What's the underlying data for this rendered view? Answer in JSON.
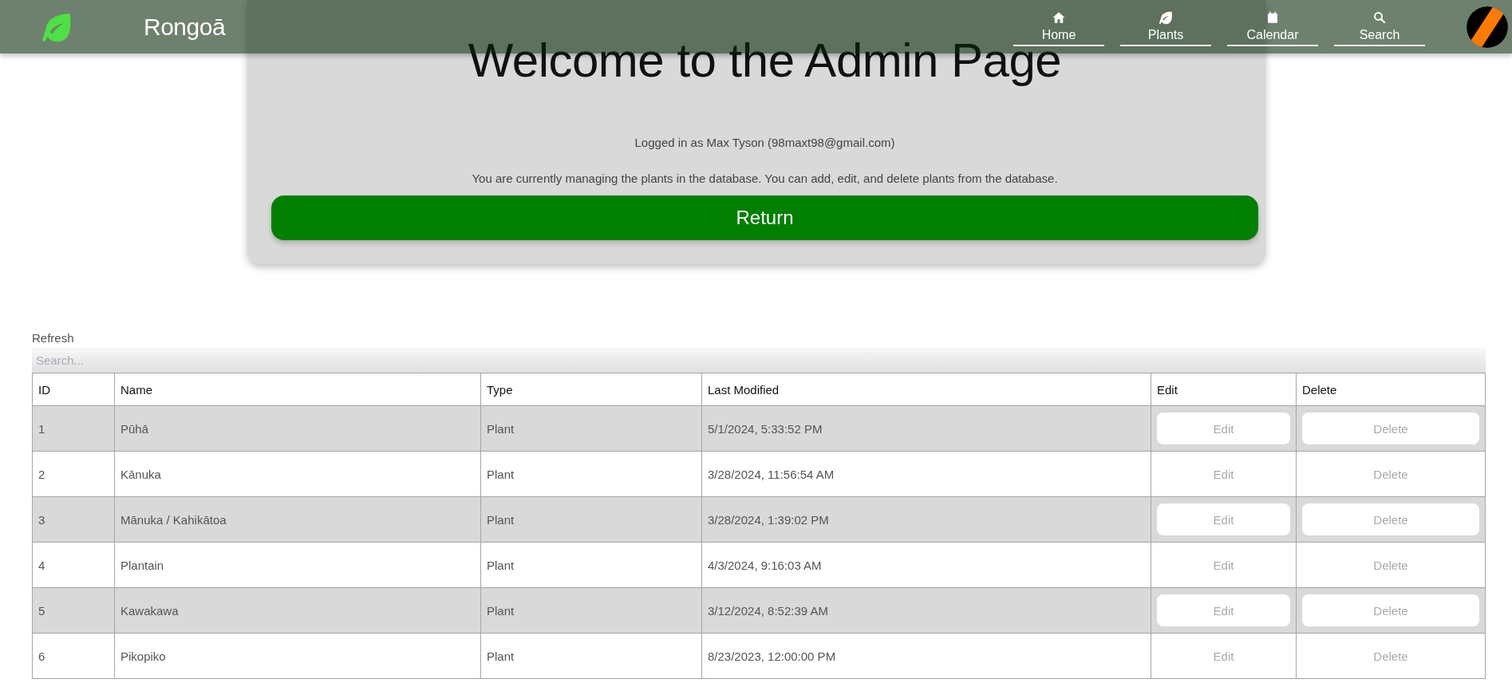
{
  "header": {
    "brand": "Rongoā",
    "nav": [
      {
        "label": "Home"
      },
      {
        "label": "Plants"
      },
      {
        "label": "Calendar"
      },
      {
        "label": "Search"
      }
    ]
  },
  "card": {
    "title": "Welcome to the Admin Page",
    "user_line": "Logged in as Max Tyson (98maxt98@gmail.com)",
    "description": "You are currently managing the plants in the database. You can add, edit, and delete plants from the database.",
    "return_button": "Return"
  },
  "table": {
    "refresh": "Refresh",
    "search": {
      "placeholder": "Search..."
    },
    "columns": [
      "ID",
      "Name",
      "Type",
      "Last Modified",
      "Edit",
      "Delete"
    ],
    "rows": [
      {
        "id": "1",
        "name": "Pūhā",
        "type": "Plant",
        "last_modified": "5/1/2024, 5:33:52 PM",
        "edit": "Edit",
        "delete": "Delete"
      },
      {
        "id": "2",
        "name": "Kānuka",
        "type": "Plant",
        "last_modified": "3/28/2024, 11:56:54 AM",
        "edit": "Edit",
        "delete": "Delete"
      },
      {
        "id": "3",
        "name": "Mānuka / Kahikātoa",
        "type": "Plant",
        "last_modified": "3/28/2024, 1:39:02 PM",
        "edit": "Edit",
        "delete": "Delete"
      },
      {
        "id": "4",
        "name": "Plantain",
        "type": "Plant",
        "last_modified": "4/3/2024, 9:16:03 AM",
        "edit": "Edit",
        "delete": "Delete"
      },
      {
        "id": "5",
        "name": "Kawakawa",
        "type": "Plant",
        "last_modified": "3/12/2024, 8:52:39 AM",
        "edit": "Edit",
        "delete": "Delete"
      },
      {
        "id": "6",
        "name": "Pikopiko",
        "type": "Plant",
        "last_modified": "8/23/2023, 12:00:00 PM",
        "edit": "Edit",
        "delete": "Delete"
      }
    ]
  }
}
